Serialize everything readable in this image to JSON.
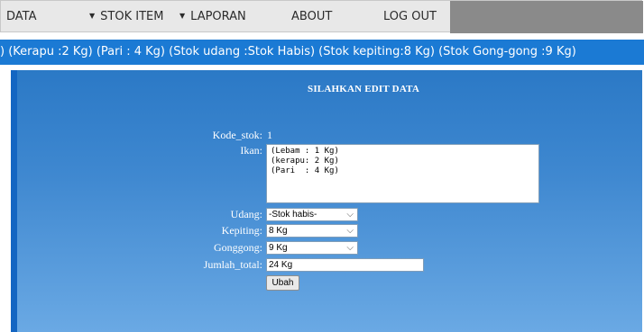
{
  "nav": {
    "items": [
      "DATA",
      "STOK ITEM",
      "LAPORAN",
      "ABOUT",
      "LOG OUT"
    ]
  },
  "ticker": {
    "text": ") (Kerapu :2 Kg) (Pari : 4 Kg) (Stok udang :Stok Habis) (Stok kepiting:8 Kg) (Stok Gong-gong :9 Kg)"
  },
  "form": {
    "title": "SILAHKAN EDIT DATA",
    "kode_stok_label": "Kode_stok:",
    "kode_stok_value": "1",
    "ikan_label": "Ikan:",
    "ikan_value": "(Lebam : 1 Kg)\n(kerapu: 2 Kg)\n(Pari  : 4 Kg)",
    "udang_label": "Udang:",
    "udang_value": "-Stok habis-",
    "kepiting_label": "Kepiting:",
    "kepiting_value": "8 Kg",
    "gonggong_label": "Gonggong:",
    "gonggong_value": "9 Kg",
    "jumlah_label": "Jumlah_total:",
    "jumlah_value": "24 Kg",
    "submit_label": "Ubah"
  }
}
